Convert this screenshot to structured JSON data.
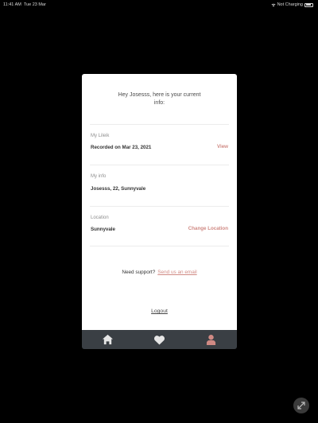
{
  "status_bar": {
    "time": "11:41 AM",
    "date": "Tue 23 Mar",
    "battery_text": "Not Charging"
  },
  "card": {
    "greeting": "Hey Josesss, here is your current info:",
    "sections": [
      {
        "label": "My Lileik",
        "value": "Recorded on Mar 23, 2021",
        "action": "View"
      },
      {
        "label": "My info",
        "value": "Josesss, 22, Sunnyvale",
        "action": ""
      },
      {
        "label": "Location",
        "value": "Sunnyvale",
        "action": "Change Location"
      }
    ],
    "support_text": "Need support?",
    "support_link": "Send us an email",
    "logout": "Logout"
  },
  "tabbar": {
    "items": [
      {
        "icon": "home-icon"
      },
      {
        "icon": "heart-icon"
      },
      {
        "icon": "profile-icon"
      }
    ]
  },
  "colors": {
    "accent": "#d08a84",
    "tabbar_bg": "#3a3f44",
    "background": "#000000"
  }
}
